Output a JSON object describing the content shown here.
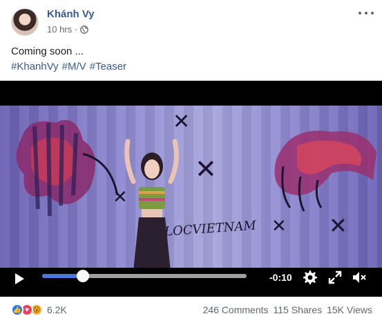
{
  "post": {
    "author": "Khánh Vy",
    "time": "10 hrs",
    "caption": "Coming soon ...",
    "hashtags": [
      "#KhanhVy",
      "#M/V",
      "#Teaser"
    ]
  },
  "video": {
    "graffiti_text": "LOCVIETNAM",
    "time_remaining": "-0:10",
    "progress": 0.2
  },
  "footer": {
    "reaction_count": "6.2K",
    "comments": "246 Comments",
    "shares": "115 Shares",
    "views": "15K Views"
  },
  "icons": {
    "privacy": "globe-icon",
    "more": "more-options-icon",
    "play": "play-icon",
    "settings": "gear-icon",
    "expand": "expand-icon",
    "mute": "volume-muted-icon"
  },
  "colors": {
    "link_blue": "#385898",
    "progress_blue": "#4a76d9",
    "like": "#2078f4",
    "love": "#f33e58",
    "wow": "#f7b125"
  }
}
